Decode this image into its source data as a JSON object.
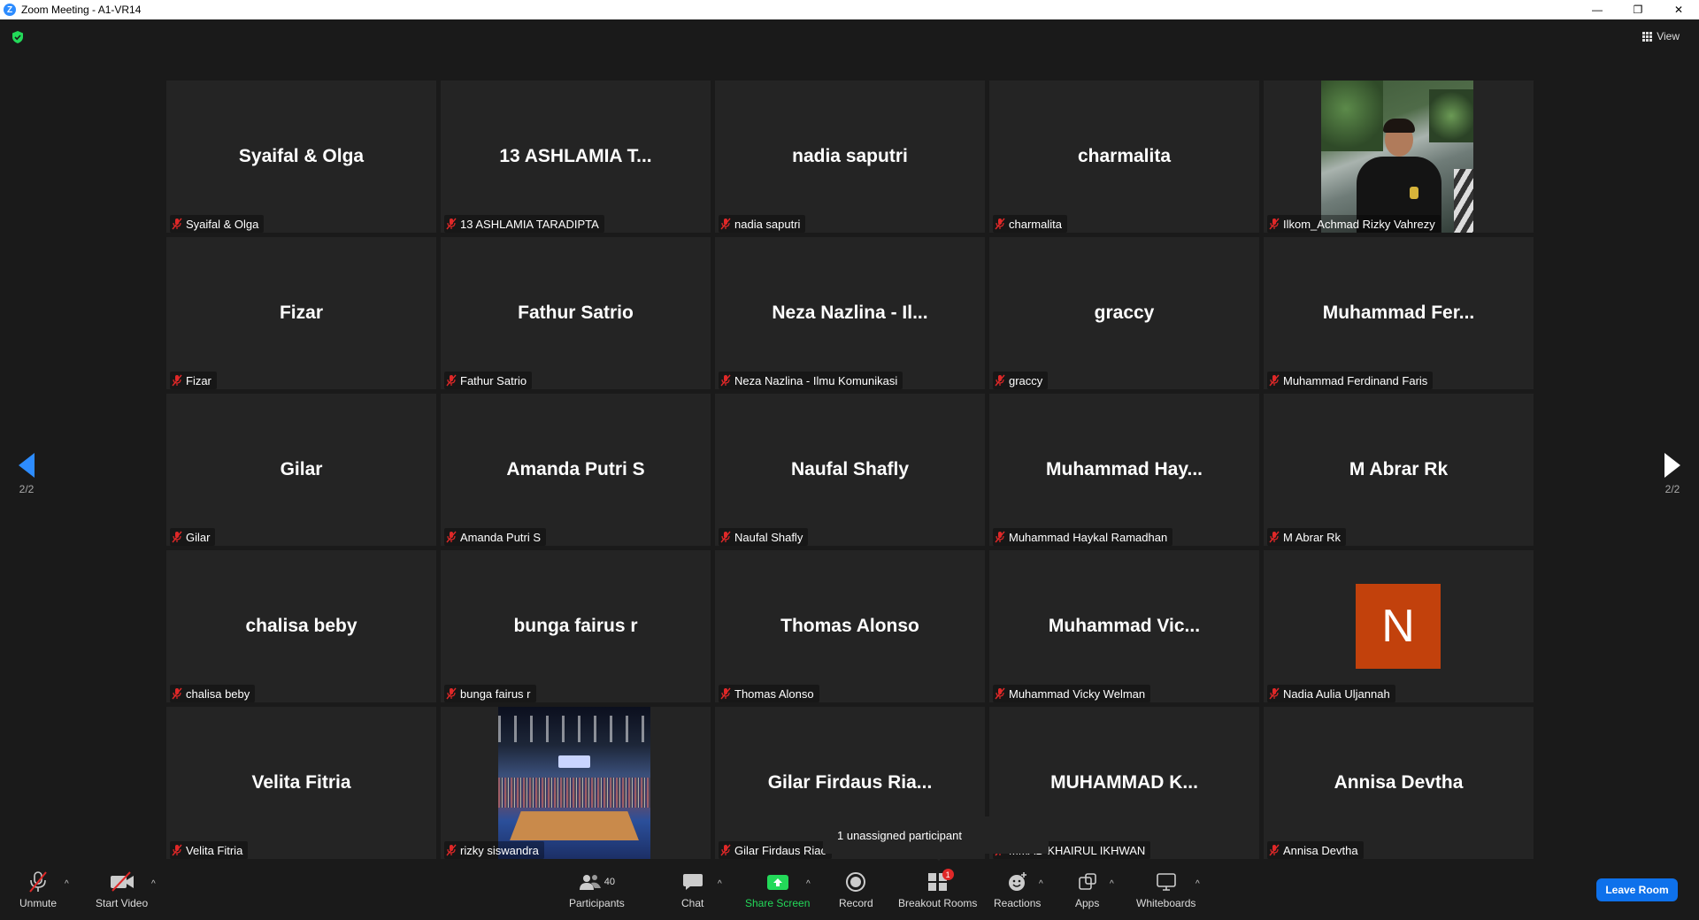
{
  "window": {
    "title": "Zoom Meeting - A1-VR14",
    "minimize": "—",
    "restore": "❐",
    "close": "✕"
  },
  "header": {
    "view_label": "View"
  },
  "pagination": {
    "left_page": "2/2",
    "right_page": "2/2"
  },
  "tiles": [
    {
      "name": "Syaifal & Olga",
      "label": "Syaifal & Olga"
    },
    {
      "name": "13  ASHLAMIA T...",
      "label": "13 ASHLAMIA TARADIPTA"
    },
    {
      "name": "nadia saputri",
      "label": "nadia saputri"
    },
    {
      "name": "charmalita",
      "label": "charmalita"
    },
    {
      "name": "",
      "label": "Ilkom_Achmad Rizky Vahrezy"
    },
    {
      "name": "Fizar",
      "label": "Fizar"
    },
    {
      "name": "Fathur Satrio",
      "label": "Fathur Satrio"
    },
    {
      "name": "Neza Nazlina - Il...",
      "label": "Neza Nazlina - Ilmu Komunikasi"
    },
    {
      "name": "graccy",
      "label": "graccy"
    },
    {
      "name": "Muhammad  Fer...",
      "label": "Muhammad Ferdinand Faris"
    },
    {
      "name": "Gilar",
      "label": "Gilar"
    },
    {
      "name": "Amanda Putri S",
      "label": "Amanda Putri S"
    },
    {
      "name": "Naufal Shafly",
      "label": "Naufal Shafly"
    },
    {
      "name": "Muhammad  Hay...",
      "label": "Muhammad Haykal Ramadhan"
    },
    {
      "name": "M Abrar Rk",
      "label": "M Abrar Rk"
    },
    {
      "name": "chalisa beby",
      "label": "chalisa beby"
    },
    {
      "name": "bunga fairus r",
      "label": "bunga fairus r"
    },
    {
      "name": "Thomas Alonso",
      "label": "Thomas Alonso"
    },
    {
      "name": "Muhammad  Vic...",
      "label": "Muhammad Vicky Welman"
    },
    {
      "name": "",
      "label": "Nadia Aulia Uljannah",
      "avatar_letter": "N"
    },
    {
      "name": "Velita Fitria",
      "label": "Velita Fitria"
    },
    {
      "name": "",
      "label": "rizky siswandra"
    },
    {
      "name": "Gilar Firdaus Ria...",
      "label": "Gilar Firdaus Riac"
    },
    {
      "name": "MUHAMMAD  K...",
      "label": "MMAD KHAIRUL IKHWAN"
    },
    {
      "name": "Annisa Devtha",
      "label": "Annisa Devtha"
    }
  ],
  "tooltip": {
    "text": "1 unassigned participant"
  },
  "toolbar": {
    "unmute": "Unmute",
    "start_video": "Start Video",
    "participants": "Participants",
    "participants_count": "40",
    "chat": "Chat",
    "share_screen": "Share Screen",
    "record": "Record",
    "breakout_rooms": "Breakout Rooms",
    "breakout_badge": "1",
    "reactions": "Reactions",
    "apps": "Apps",
    "whiteboards": "Whiteboards",
    "leave_room": "Leave Room"
  },
  "colors": {
    "accent": "#2d8cff",
    "share_green": "#23d959",
    "leave_blue": "#0e71eb",
    "muted_red": "#e02828",
    "avatar_orange": "#c2410c"
  }
}
